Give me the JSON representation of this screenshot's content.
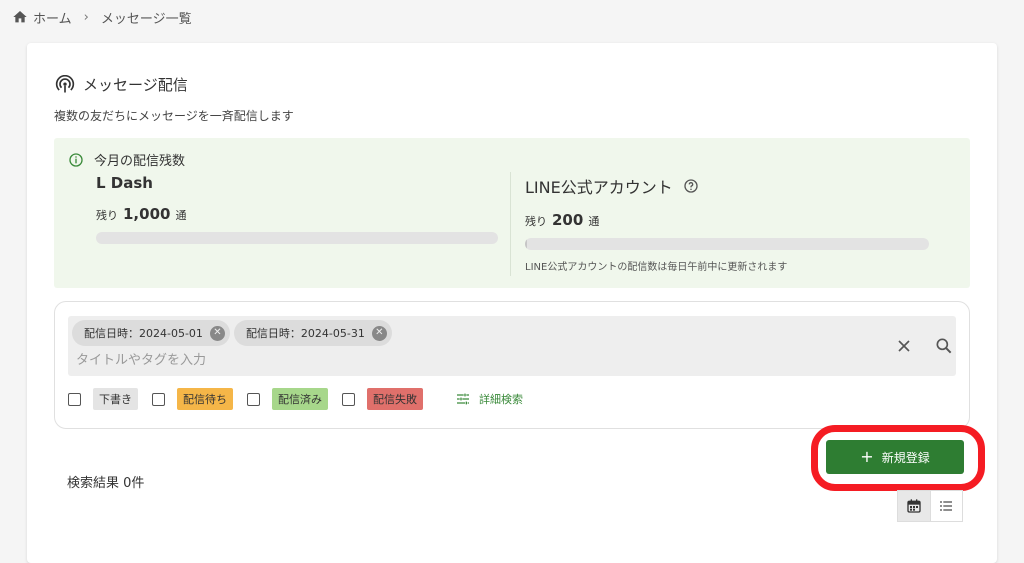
{
  "breadcrumb": {
    "home": "ホーム",
    "current": "メッセージ一覧"
  },
  "header": {
    "title": "メッセージ配信",
    "subtitle": "複数の友だちにメッセージを一斉配信します"
  },
  "quota": {
    "heading": "今月の配信残数",
    "ldash": {
      "name": "L Dash",
      "remain_prefix": "残り",
      "remain_value": "1,000",
      "remain_unit": "通",
      "usage_fraction": 0.0
    },
    "line": {
      "name": "LINE公式アカウント",
      "remain_prefix": "残り",
      "remain_value": "200",
      "remain_unit": "通",
      "usage_fraction": 0.005,
      "note": "LINE公式アカウントの配信数は毎日午前中に更新されます"
    }
  },
  "search": {
    "chips": [
      {
        "label": "配信日時：2024-05-01"
      },
      {
        "label": "配信日時：2024-05-31"
      }
    ],
    "placeholder": "タイトルやタグを入力",
    "value": ""
  },
  "filters": [
    {
      "label": "下書き",
      "checked": false
    },
    {
      "label": "配信待ち",
      "checked": false
    },
    {
      "label": "配信済み",
      "checked": false
    },
    {
      "label": "配信失敗",
      "checked": false
    }
  ],
  "advanced_search_label": "詳細検索",
  "new_button_label": "新規登録",
  "result_count": "検索結果 0件",
  "colors": {
    "primary_green": "#2e7d32",
    "highlight_red": "#f51c23",
    "quota_bg": "#f0f7ec",
    "tag_waiting": "#f5b648",
    "tag_done": "#a7d78b",
    "tag_failed": "#e0706b"
  },
  "icons": {
    "home": "home-icon",
    "title": "signal-icon",
    "info": "info-icon",
    "help": "help-icon",
    "clear": "close-icon",
    "search": "search-icon",
    "tune": "tune-icon",
    "calendar": "calendar-icon",
    "list": "list-icon"
  }
}
